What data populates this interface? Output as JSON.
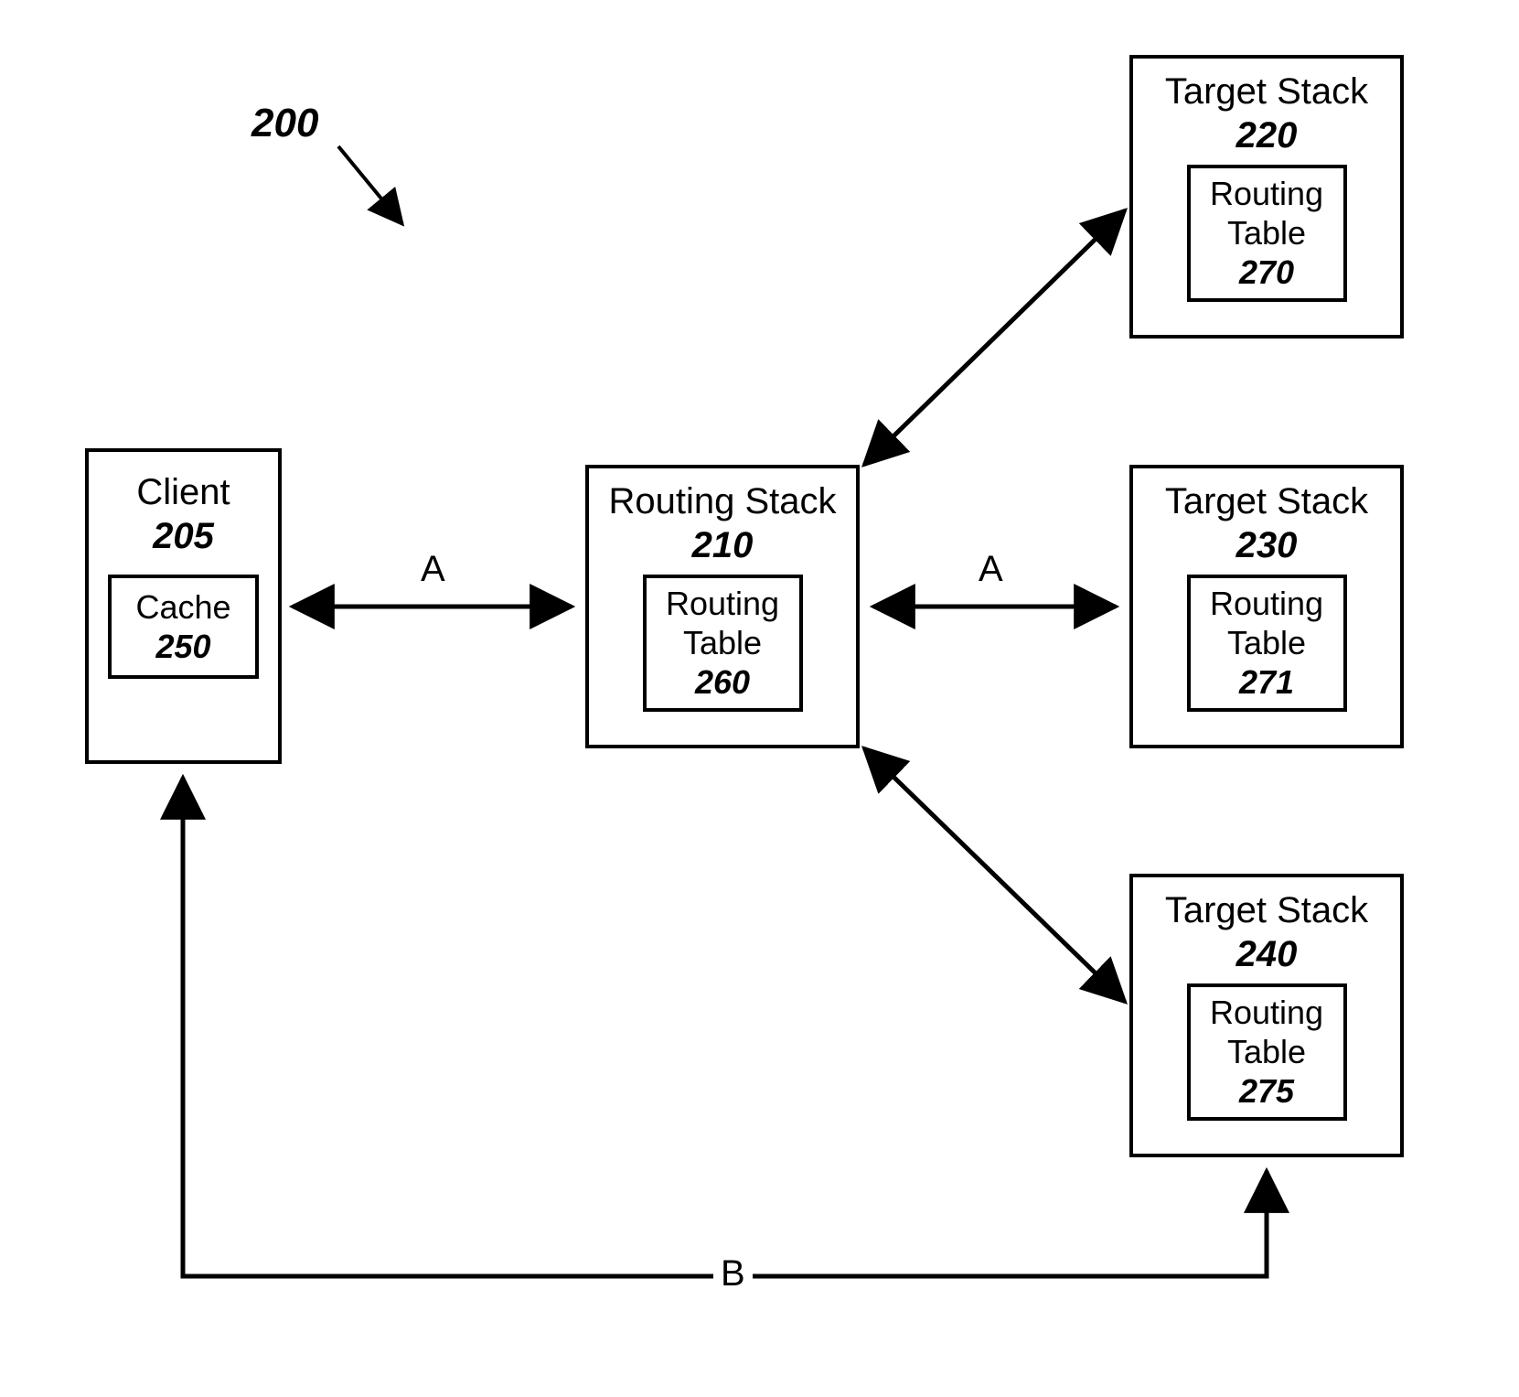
{
  "figure": {
    "id": "200"
  },
  "client": {
    "title": "Client",
    "id": "205",
    "inner": {
      "title": "Cache",
      "id": "250"
    }
  },
  "router": {
    "title": "Routing Stack",
    "id": "210",
    "inner": {
      "title": "Routing",
      "title2": "Table",
      "id": "260"
    }
  },
  "targets": [
    {
      "title": "Target Stack",
      "id": "220",
      "inner": {
        "title": "Routing",
        "title2": "Table",
        "id": "270"
      }
    },
    {
      "title": "Target Stack",
      "id": "230",
      "inner": {
        "title": "Routing",
        "title2": "Table",
        "id": "271"
      }
    },
    {
      "title": "Target Stack",
      "id": "240",
      "inner": {
        "title": "Routing",
        "title2": "Table",
        "id": "275"
      }
    }
  ],
  "edges": {
    "client_router": "A",
    "router_target1": "A",
    "client_target2_return": "B"
  }
}
